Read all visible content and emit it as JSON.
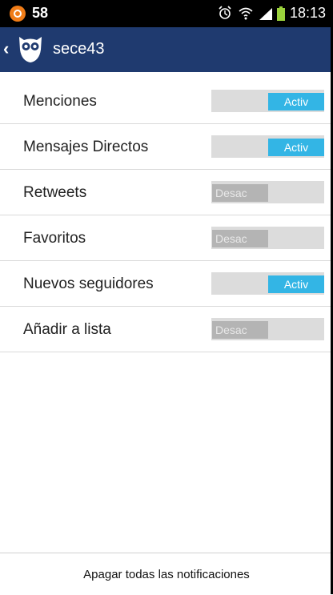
{
  "status_bar": {
    "notification_count": "58",
    "time": "18:13",
    "icons": [
      "notification-icon",
      "alarm-icon",
      "wifi-icon",
      "signal-icon",
      "battery-icon"
    ]
  },
  "app_bar": {
    "back_icon": "chevron-left-icon",
    "logo_icon": "owl-icon",
    "title": "sece43"
  },
  "settings": [
    {
      "label": "Menciones",
      "state": "on",
      "toggle_text": "Activ"
    },
    {
      "label": "Mensajes Directos",
      "state": "on",
      "toggle_text": "Activ"
    },
    {
      "label": "Retweets",
      "state": "off",
      "toggle_text": "Desac"
    },
    {
      "label": "Favoritos",
      "state": "off",
      "toggle_text": "Desac"
    },
    {
      "label": "Nuevos seguidores",
      "state": "on",
      "toggle_text": "Activ"
    },
    {
      "label": "Añadir a lista",
      "state": "off",
      "toggle_text": "Desac"
    }
  ],
  "footer": {
    "button_label": "Apagar todas las notificaciones"
  },
  "colors": {
    "app_bar": "#1f3a6f",
    "toggle_on": "#33b5e5",
    "toggle_off": "#b4b4b4",
    "notification_badge": "#f07c17"
  }
}
